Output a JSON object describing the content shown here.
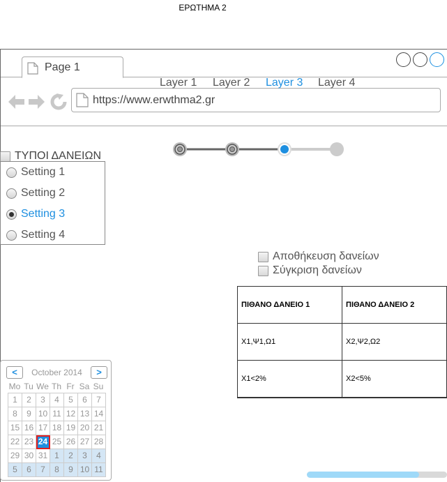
{
  "page": {
    "title": "ΕΡΩΤΗΜΑ 2"
  },
  "browser": {
    "tab_label": "Page 1",
    "url": "https://www.erwthma2.gr"
  },
  "stepper": {
    "labels": [
      "Layer 1",
      "Layer 2",
      "Layer 3",
      "Layer 4"
    ],
    "active_index": 2
  },
  "loan_types": {
    "header": "ΤΥΠΟΙ ΔΑΝΕΙΩΝ",
    "options": [
      "Setting 1",
      "Setting 2",
      "Setting 3",
      "Setting 4"
    ],
    "selected_index": 2
  },
  "actions": {
    "save_loans": "Αποθήκευση δανείων",
    "compare_loans": "Σύγκριση δανείων"
  },
  "loan_table": {
    "headers": [
      "ΠΙΘΑΝΟ ΔΑΝΕΙΟ 1",
      "ΠΙΘΑΝΟ ΔΑΝΕΙΟ 2"
    ],
    "rows": [
      [
        "X1,Ψ1,Ω1",
        "X2,Ψ2,Ω2"
      ],
      [
        "X1<2%",
        "X2<5%"
      ]
    ]
  },
  "calendar": {
    "month_label": "October 2014",
    "prev_label": "<",
    "next_label": ">",
    "weekdays": [
      "Mo",
      "Tu",
      "We",
      "Th",
      "Fr",
      "Sa",
      "Su"
    ],
    "days": [
      "1",
      "2",
      "3",
      "4",
      "5",
      "6",
      "7",
      "8",
      "9",
      "10",
      "11",
      "12",
      "13",
      "14",
      "15",
      "16",
      "17",
      "18",
      "19",
      "20",
      "21",
      "22",
      "23",
      "24",
      "25",
      "26",
      "27",
      "28",
      "29",
      "30",
      "31",
      "1",
      "2",
      "3",
      "4",
      "5",
      "6",
      "7",
      "8",
      "9",
      "10",
      "11"
    ],
    "selected_day": "24"
  },
  "progress": {
    "value": 0.8
  },
  "colors": {
    "accent": "#1e8fe0",
    "today_border": "#e02020"
  },
  "icons": {
    "back": "arrow-left-icon",
    "forward": "arrow-right-icon",
    "reload": "reload-icon",
    "page": "page-icon"
  }
}
